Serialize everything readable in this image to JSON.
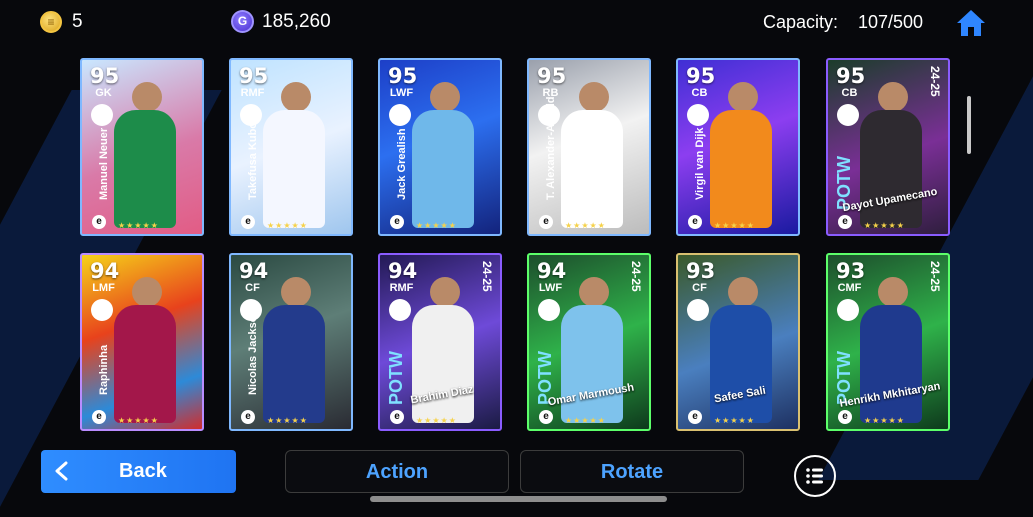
{
  "header": {
    "coins": "5",
    "gp": "185,260",
    "capacity_label": "Capacity:",
    "capacity_value": "107/500",
    "coin_symbol": "≡",
    "gp_symbol": "G"
  },
  "cards": [
    {
      "ovr": "95",
      "pos": "GK",
      "name": "Manuel Neuer",
      "name_style": "vert",
      "bg": "linear-gradient(160deg,#c9e7ff 0%,#d97aa8 55%,#e25c85 100%)",
      "border": "#7fb8ff",
      "kit": "#1d8c4a",
      "tag": "",
      "potw": false
    },
    {
      "ovr": "95",
      "pos": "RMF",
      "name": "Takefusa Kubo",
      "name_style": "vert",
      "bg": "linear-gradient(160deg,#bfe3ff 0%,#e9f2ff 50%,#9fc6ee 100%)",
      "border": "#7fb8ff",
      "kit": "#f4f7ff",
      "tag": "",
      "potw": false
    },
    {
      "ovr": "95",
      "pos": "LWF",
      "name": "Jack Grealish",
      "name_style": "vert",
      "bg": "linear-gradient(160deg,#1d3fc7 0%,#2c6ff0 45%,#13237c 100%)",
      "border": "#7fb8ff",
      "kit": "#6fb8ea",
      "tag": "",
      "potw": false
    },
    {
      "ovr": "95",
      "pos": "RB",
      "name": "T. Alexander-Arnold",
      "name_style": "vert",
      "bg": "linear-gradient(160deg,#9aa0ac 0%,#f2f2f2 45%,#bcbcbc 100%)",
      "border": "#7fb8ff",
      "kit": "#ffffff",
      "tag": "",
      "potw": false
    },
    {
      "ovr": "95",
      "pos": "CB",
      "name": "Virgil van Dijk",
      "name_style": "vert",
      "bg": "linear-gradient(160deg,#3f2fd4 0%,#8c3ef0 45%,#1a1aa0 100%)",
      "border": "#7fb8ff",
      "kit": "#f28a1c",
      "tag": "",
      "potw": false
    },
    {
      "ovr": "95",
      "pos": "CB",
      "name": "Dayot Upamecano",
      "name_style": "horiz",
      "bg": "linear-gradient(160deg,#1b3d2a 0%,#7a2f96 55%,#2f1e3e 100%)",
      "border": "#8a5cff",
      "kit": "#2e2a30",
      "tag": "24-25",
      "potw": true
    },
    {
      "ovr": "94",
      "pos": "LMF",
      "name": "Raphinha",
      "name_style": "vert",
      "bg": "linear-gradient(160deg,#f5d21a 0%,#e8421c 40%,#2d8ad8 75%,#d12d2d 100%)",
      "border": "#b98cff",
      "kit": "#a3174a",
      "tag": "",
      "potw": false
    },
    {
      "ovr": "94",
      "pos": "CF",
      "name": "Nicolas Jackson",
      "name_style": "vert",
      "bg": "linear-gradient(160deg,#2b4a42 0%,#5e7e77 45%,#2a2b33 100%)",
      "border": "#7fb8ff",
      "kit": "#233b8c",
      "tag": "",
      "potw": false
    },
    {
      "ovr": "94",
      "pos": "RMF",
      "name": "Brahim Diaz",
      "name_style": "horiz",
      "bg": "linear-gradient(160deg,#231a55 0%,#6e4ad8 50%,#1b1b44 100%)",
      "border": "#8a5cff",
      "kit": "#f0f0f0",
      "tag": "24-25",
      "potw": true
    },
    {
      "ovr": "94",
      "pos": "LWF",
      "name": "Omar Marmoush",
      "name_style": "horiz",
      "bg": "linear-gradient(160deg,#1d4e2c 0%,#2fb24a 50%,#0e3a1c 100%)",
      "border": "#5cff6a",
      "kit": "#7ec2ec",
      "tag": "24-25",
      "potw": true
    },
    {
      "ovr": "93",
      "pos": "CF",
      "name": "Safee Sali",
      "name_style": "horiz",
      "bg": "linear-gradient(160deg,#3b5a2a 0%,#4a7fbf 55%,#1e3162 100%)",
      "border": "#d9c070",
      "kit": "#1e4ea8",
      "tag": "",
      "potw": false
    },
    {
      "ovr": "93",
      "pos": "CMF",
      "name": "Henrikh Mkhitaryan",
      "name_style": "horiz",
      "bg": "linear-gradient(160deg,#1d4e2c 0%,#2fb24a 50%,#0e3a1c 100%)",
      "border": "#5cff6a",
      "kit": "#1f3a8e",
      "tag": "24-25",
      "potw": true
    }
  ],
  "potw_label": "POTW",
  "stars": "★★★★★",
  "footer": {
    "back": "Back",
    "action": "Action",
    "rotate": "Rotate"
  }
}
